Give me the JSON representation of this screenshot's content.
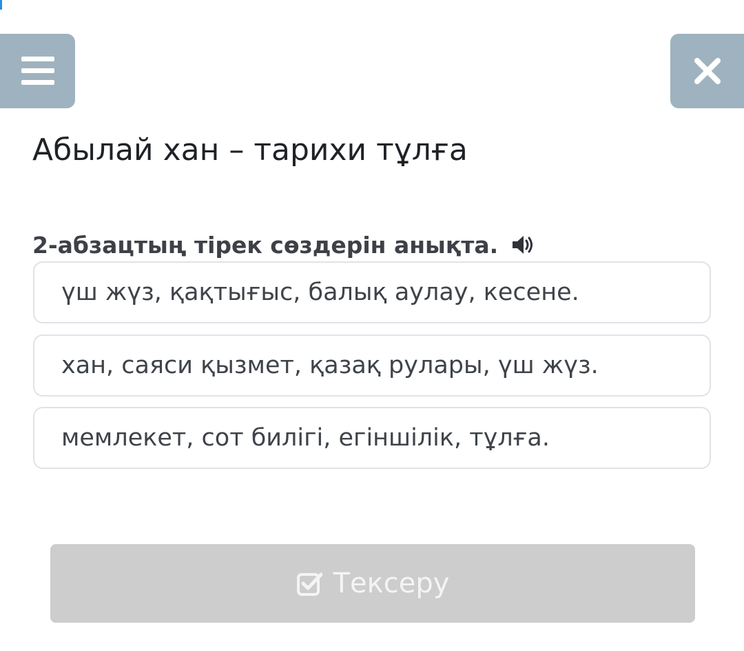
{
  "header": {
    "menu_icon": "hamburger-menu-icon",
    "close_icon": "close-x-icon"
  },
  "lesson": {
    "title": "Абылай хан – тарихи тұлға"
  },
  "question": {
    "text": "2-абзацтың тірек сөздерін анықта.",
    "audio_icon": "speaker-icon"
  },
  "options": [
    {
      "label": "үш жүз, қақтығыс, балық аулау, кесене."
    },
    {
      "label": "хан, саяси қызмет, қазақ рулары, үш жүз."
    },
    {
      "label": "мемлекет, сот билігі, егіншілік, тұлға."
    }
  ],
  "check_button": {
    "label": "Тексеру",
    "icon": "checkbox-check-icon",
    "enabled": false
  },
  "colors": {
    "header_button_bg": "#9eb3bf",
    "option_border": "#dfe3e6",
    "disabled_button_bg": "#cdcdcd",
    "text_dark": "#1f2226"
  }
}
